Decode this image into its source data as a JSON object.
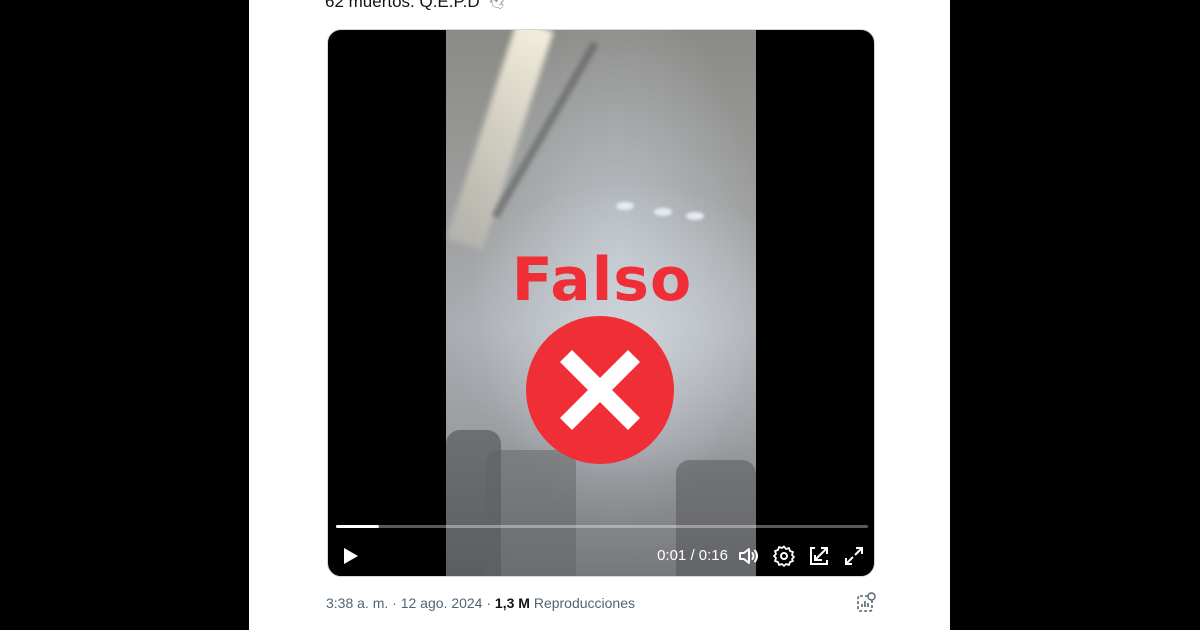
{
  "tweet": {
    "text": "62 muertos. Q.E.P.D",
    "emoji": "🕊"
  },
  "video": {
    "overlay_label": "Falso",
    "overlay_icon": "red-circle-x-icon",
    "progress_fraction": 0.08,
    "current_time": "0:01",
    "separator": " / ",
    "duration": "0:16",
    "controls": [
      "play-icon",
      "volume-icon",
      "settings-icon",
      "pip-icon",
      "fullscreen-icon"
    ]
  },
  "meta": {
    "time": "3:38 a. m.",
    "dot": " · ",
    "date": "12 ago. 2024",
    "dot2": " · ",
    "views_count": "1,3 M",
    "views_label": "Reproducciones",
    "analytics_icon": "analytics-icon"
  },
  "colors": {
    "falso_red": "#ef2f35",
    "background": "#000000",
    "card": "#ffffff"
  }
}
